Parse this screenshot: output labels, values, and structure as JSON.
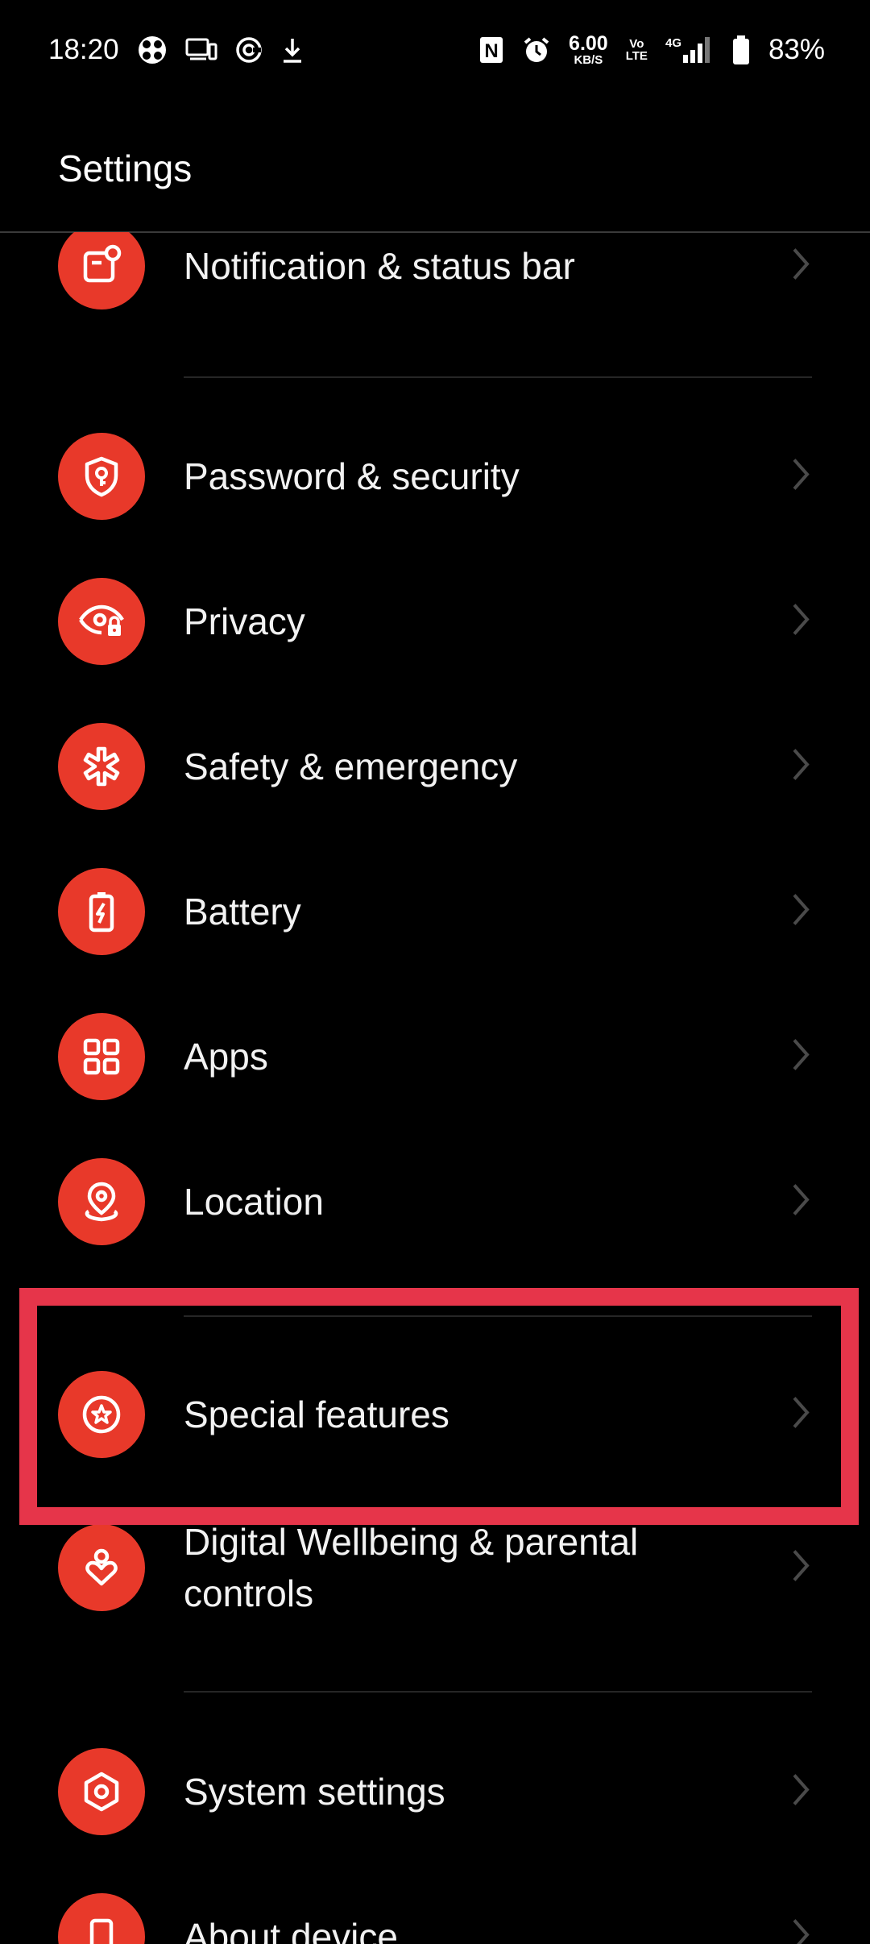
{
  "status_bar": {
    "time": "18:20",
    "left_icons": [
      "app-icon",
      "cast-icon",
      "sync-icon",
      "download-icon"
    ],
    "nfc": "N",
    "speed_value": "6.00",
    "speed_unit": "KB/S",
    "volte_top": "Vo",
    "volte_bottom": "LTE",
    "network": "4G",
    "battery_percent": "83%"
  },
  "header": {
    "title": "Settings"
  },
  "items": [
    {
      "label": "Notification & status bar",
      "icon": "notification-icon"
    },
    {
      "label": "Password & security",
      "icon": "shield-key-icon"
    },
    {
      "label": "Privacy",
      "icon": "eye-lock-icon"
    },
    {
      "label": "Safety & emergency",
      "icon": "asterisk-icon"
    },
    {
      "label": "Battery",
      "icon": "battery-icon"
    },
    {
      "label": "Apps",
      "icon": "apps-grid-icon"
    },
    {
      "label": "Location",
      "icon": "location-pin-icon"
    },
    {
      "label": "Special features",
      "icon": "star-circle-icon"
    },
    {
      "label": "Digital Wellbeing & parental controls",
      "icon": "person-heart-icon"
    },
    {
      "label": "System settings",
      "icon": "hexagon-gear-icon"
    },
    {
      "label": "About device",
      "icon": "phone-icon"
    }
  ],
  "colors": {
    "background": "#000000",
    "accent": "#e8392a",
    "highlight": "#e6354a",
    "text": "#f2f2f2",
    "chevron": "#4a4a4a"
  }
}
